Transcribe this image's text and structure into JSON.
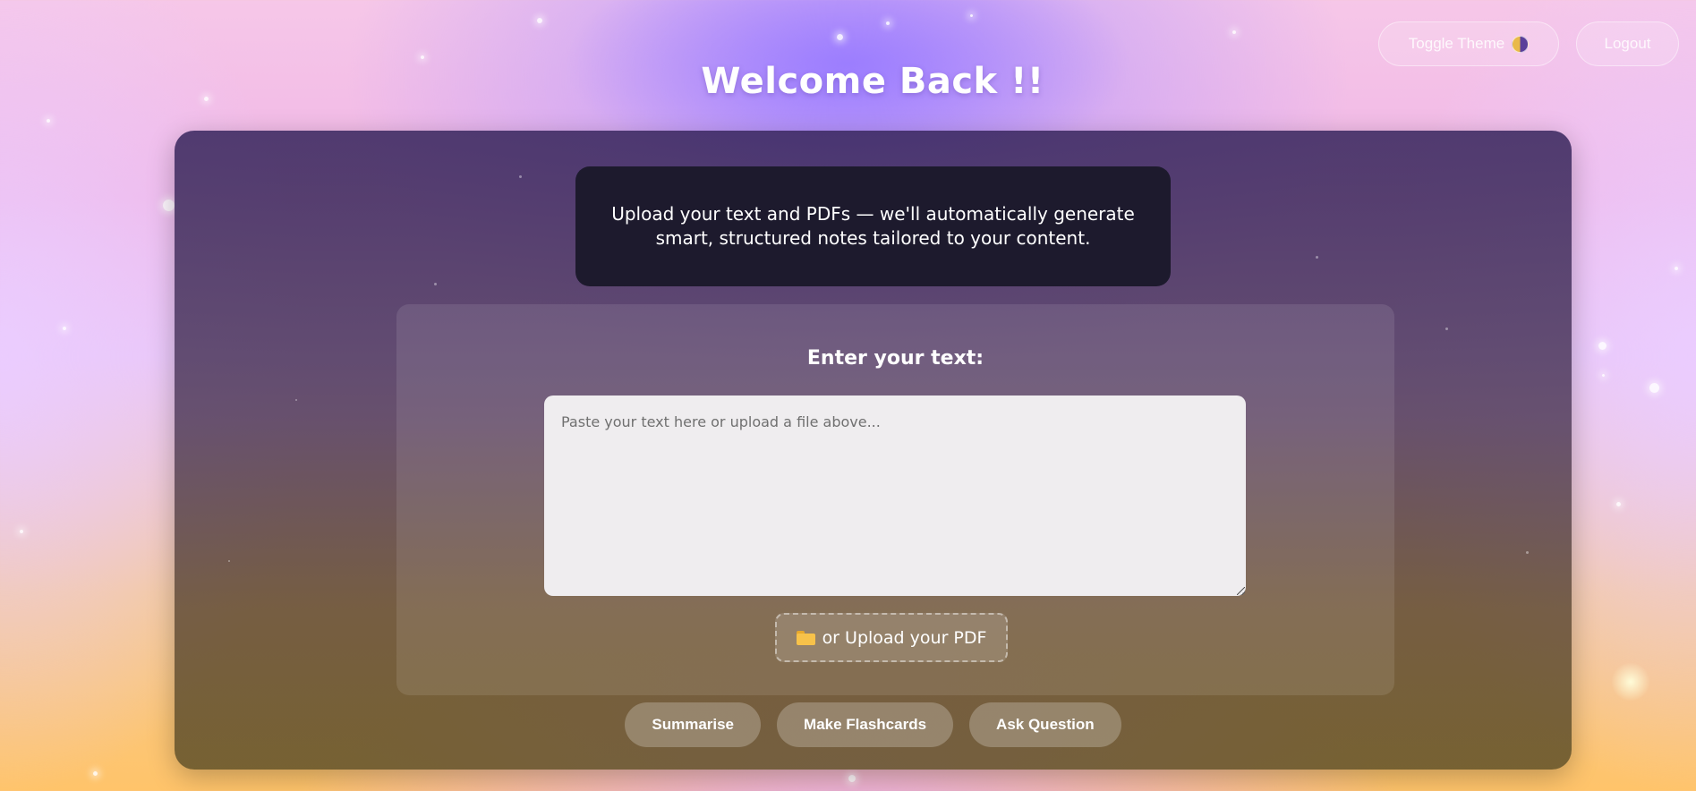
{
  "header": {
    "toggle_theme_label": "Toggle Theme",
    "logout_label": "Logout",
    "title": "Welcome Back !!"
  },
  "info": {
    "text": "Upload your text and PDFs — we'll automatically generate smart, structured notes tailored to your content."
  },
  "input_panel": {
    "label": "Enter your text:",
    "placeholder": "Paste your text here or upload a file above...",
    "value": "",
    "upload_label": "or Upload your PDF"
  },
  "actions": {
    "summarise_label": "Summarise",
    "flashcards_label": "Make Flashcards",
    "ask_label": "Ask Question"
  },
  "icons": {
    "theme": "half-moon-icon",
    "upload": "folder-icon"
  },
  "colors": {
    "card_background": "#3a285f",
    "info_box": "#1d1a2d",
    "text_input": "#efedef",
    "folder": "#f7c24a",
    "text": "#ffffff"
  }
}
